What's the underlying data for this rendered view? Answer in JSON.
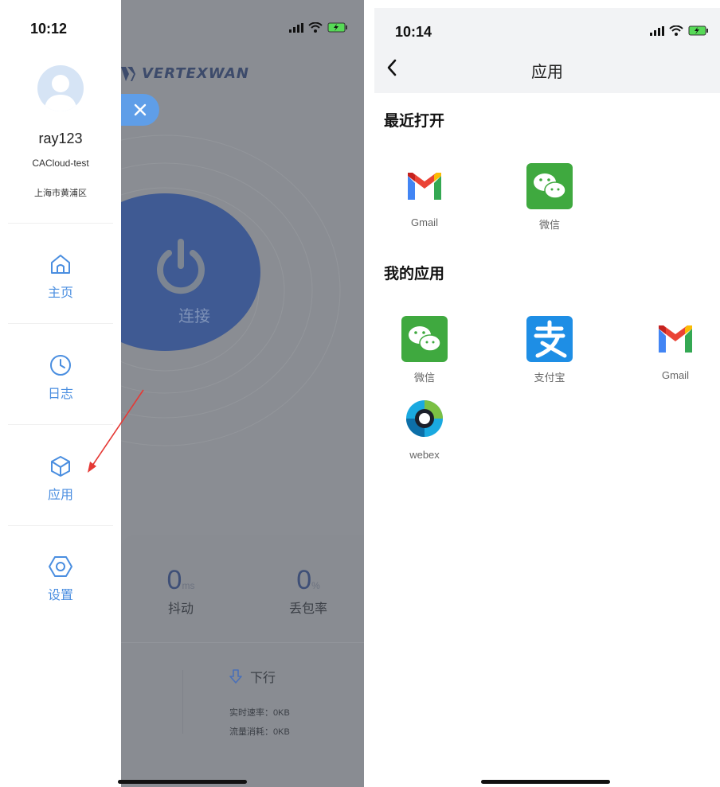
{
  "left": {
    "status": {
      "time": "10:12"
    },
    "drawer": {
      "username": "ray123",
      "org": "CACloud-test",
      "location": "上海市黄浦区",
      "nav": [
        {
          "label": "主页",
          "icon": "home-icon"
        },
        {
          "label": "日志",
          "icon": "clock-icon"
        },
        {
          "label": "应用",
          "icon": "cube-icon"
        },
        {
          "label": "设置",
          "icon": "hex-settings-icon"
        }
      ]
    },
    "background": {
      "brand": "VERTEXWAN",
      "connect_label": "连接",
      "jitter": {
        "value": "0",
        "unit": "ms",
        "label": "抖动"
      },
      "loss": {
        "value": "0",
        "unit": "%",
        "label": "丢包率"
      },
      "download": {
        "label": "下行",
        "speed": "实时速率：0KB",
        "usage": "流量消耗：0KB"
      }
    }
  },
  "right": {
    "status": {
      "time": "10:14"
    },
    "title": "应用",
    "recent_title": "最近打开",
    "recent_apps": [
      {
        "name": "Gmail",
        "icon": "gmail-icon"
      },
      {
        "name": "微信",
        "icon": "wechat-icon"
      }
    ],
    "my_apps_title": "我的应用",
    "my_apps": [
      {
        "name": "微信",
        "icon": "wechat-icon"
      },
      {
        "name": "支付宝",
        "icon": "alipay-icon"
      },
      {
        "name": "Gmail",
        "icon": "gmail-icon"
      },
      {
        "name": "webex",
        "icon": "webex-icon"
      }
    ]
  },
  "colors": {
    "accent": "#4a8ee0",
    "dim_background": "#8a8d93",
    "wechat_green": "#3fa93f",
    "alipay_blue": "#1e8ee5",
    "annotation_red": "#e53935"
  }
}
